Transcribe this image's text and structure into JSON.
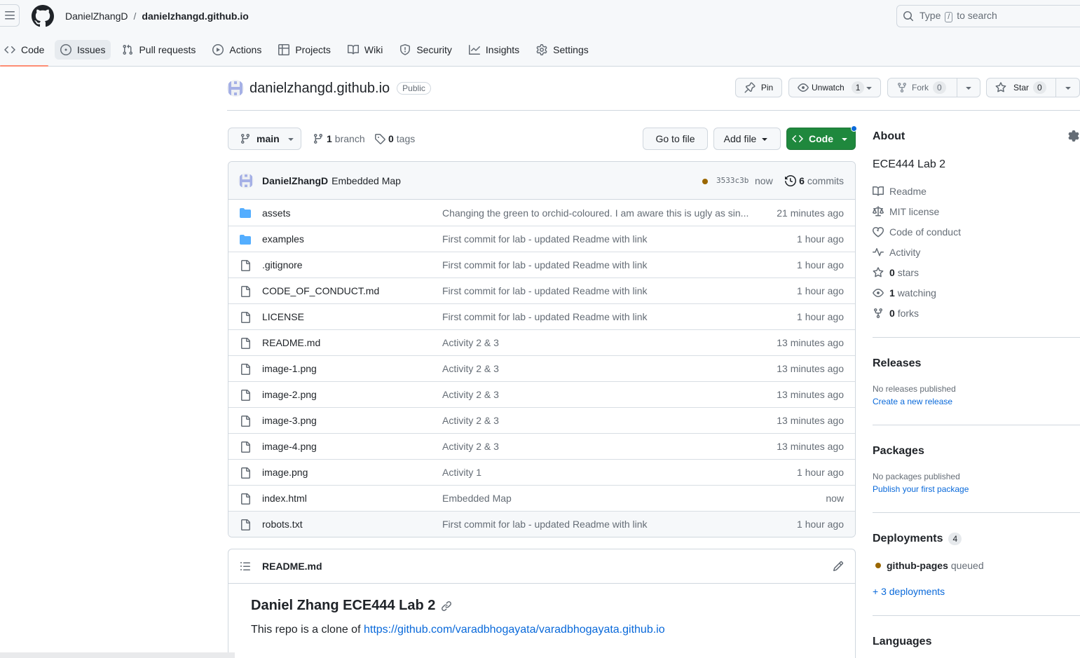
{
  "header": {
    "owner": "DanielZhangD",
    "separator": "/",
    "repo": "danielzhangd.github.io",
    "search_prefix": "Type",
    "search_key": "/",
    "search_suffix": "to search"
  },
  "nav": {
    "tabs": [
      {
        "label": "Code",
        "icon": "code-icon"
      },
      {
        "label": "Issues",
        "icon": "issue-opened-icon"
      },
      {
        "label": "Pull requests",
        "icon": "git-pull-request-icon"
      },
      {
        "label": "Actions",
        "icon": "play-icon"
      },
      {
        "label": "Projects",
        "icon": "table-icon"
      },
      {
        "label": "Wiki",
        "icon": "book-icon"
      },
      {
        "label": "Security",
        "icon": "shield-icon"
      },
      {
        "label": "Insights",
        "icon": "graph-icon"
      },
      {
        "label": "Settings",
        "icon": "gear-icon"
      }
    ]
  },
  "repo_header": {
    "name": "danielzhangd.github.io",
    "visibility": "Public",
    "pin_label": "Pin",
    "unwatch_label": "Unwatch",
    "watch_count": "1",
    "fork_label": "Fork",
    "fork_count": "0",
    "star_label": "Star",
    "star_count": "0"
  },
  "toolbar": {
    "branch": "main",
    "branch_count": "1",
    "branch_word": "branch",
    "tag_count": "0",
    "tag_word": "tags",
    "go_to_file": "Go to file",
    "add_file": "Add file",
    "code": "Code"
  },
  "latest_commit": {
    "author": "DanielZhangD",
    "message": "Embedded Map",
    "sha": "3533c3b",
    "time": "now",
    "commit_count": "6",
    "commit_word": "commits",
    "status_color": "#9a6700"
  },
  "files": [
    {
      "name": "assets",
      "type": "folder",
      "message": "Changing the green to orchid-coloured. I am aware this is ugly as sin...",
      "age": "21 minutes ago"
    },
    {
      "name": "examples",
      "type": "folder",
      "message": "First commit for lab - updated Readme with link",
      "age": "1 hour ago"
    },
    {
      "name": ".gitignore",
      "type": "file",
      "message": "First commit for lab - updated Readme with link",
      "age": "1 hour ago"
    },
    {
      "name": "CODE_OF_CONDUCT.md",
      "type": "file",
      "message": "First commit for lab - updated Readme with link",
      "age": "1 hour ago"
    },
    {
      "name": "LICENSE",
      "type": "file",
      "message": "First commit for lab - updated Readme with link",
      "age": "1 hour ago"
    },
    {
      "name": "README.md",
      "type": "file",
      "message": "Activity 2 & 3",
      "age": "13 minutes ago"
    },
    {
      "name": "image-1.png",
      "type": "file",
      "message": "Activity 2 & 3",
      "age": "13 minutes ago"
    },
    {
      "name": "image-2.png",
      "type": "file",
      "message": "Activity 2 & 3",
      "age": "13 minutes ago"
    },
    {
      "name": "image-3.png",
      "type": "file",
      "message": "Activity 2 & 3",
      "age": "13 minutes ago"
    },
    {
      "name": "image-4.png",
      "type": "file",
      "message": "Activity 2 & 3",
      "age": "13 minutes ago"
    },
    {
      "name": "image.png",
      "type": "file",
      "message": "Activity 1",
      "age": "1 hour ago"
    },
    {
      "name": "index.html",
      "type": "file",
      "message": "Embedded Map",
      "age": "now"
    },
    {
      "name": "robots.txt",
      "type": "file",
      "message": "First commit for lab - updated Readme with link",
      "age": "1 hour ago"
    }
  ],
  "readme": {
    "filename": "README.md",
    "heading": "Daniel Zhang ECE444 Lab 2",
    "text": "This repo is a clone of",
    "link": "https://github.com/varadbhogayata/varadbhogayata.github.io"
  },
  "about": {
    "title": "About",
    "description": "ECE444 Lab 2",
    "readme": "Readme",
    "license": "MIT license",
    "conduct": "Code of conduct",
    "activity": "Activity",
    "stars_count": "0",
    "stars_word": "stars",
    "watching_count": "1",
    "watching_word": "watching",
    "forks_count": "0",
    "forks_word": "forks"
  },
  "releases": {
    "title": "Releases",
    "empty": "No releases published",
    "create": "Create a new release"
  },
  "packages": {
    "title": "Packages",
    "empty": "No packages published",
    "publish": "Publish your first package"
  },
  "deployments": {
    "title": "Deployments",
    "count": "4",
    "env": "github-pages",
    "status": "queued",
    "more": "+ 3 deployments"
  },
  "languages": {
    "title": "Languages"
  },
  "colors": {
    "accent": "#0969da",
    "primary_button": "#1f883d",
    "selected_tab_underline": "#fd8c73",
    "folder": "#54aeff"
  }
}
